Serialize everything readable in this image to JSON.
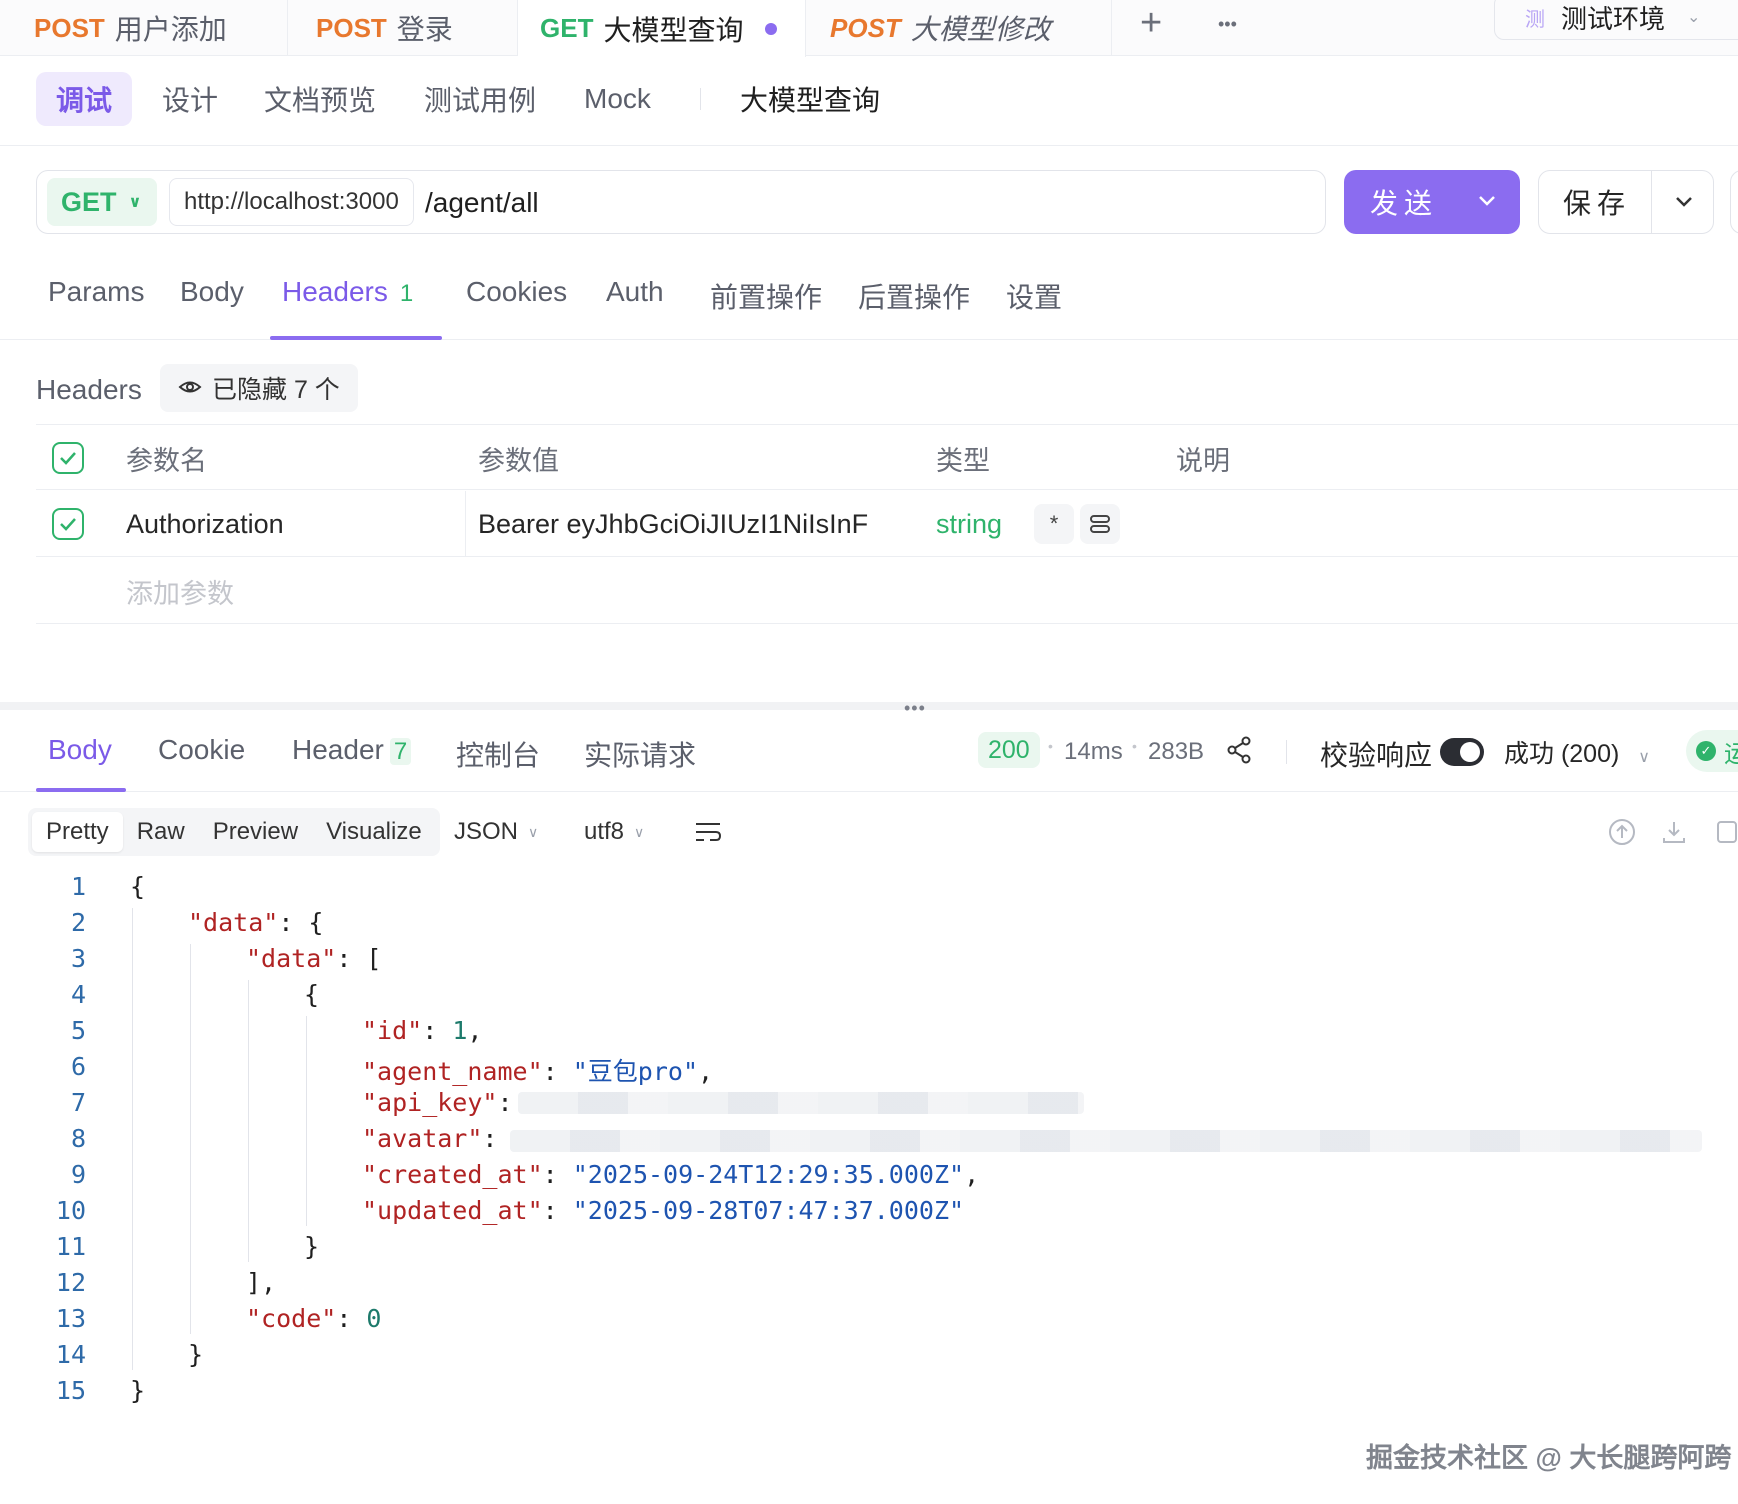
{
  "top_tabs": [
    {
      "method": "POST",
      "title": "用户添加"
    },
    {
      "method": "POST",
      "title": "登录"
    },
    {
      "method": "GET",
      "title": "大模型查询"
    },
    {
      "method": "POST",
      "title": "大模型修改"
    }
  ],
  "top_actions": {
    "add": "+",
    "more": "•••"
  },
  "environment": {
    "badge": "测",
    "label": "测试环境"
  },
  "subnav": {
    "items": [
      "调试",
      "设计",
      "文档预览",
      "测试用例",
      "Mock"
    ],
    "name": "大模型查询"
  },
  "request": {
    "method": "GET",
    "host": "http://localhost:3000",
    "path": "/agent/all",
    "send_label": "发送",
    "save_label": "保存"
  },
  "request_tabs": [
    {
      "label": "Params"
    },
    {
      "label": "Body"
    },
    {
      "label": "Headers",
      "count": "1"
    },
    {
      "label": "Cookies"
    },
    {
      "label": "Auth"
    },
    {
      "label": "前置操作"
    },
    {
      "label": "后置操作"
    },
    {
      "label": "设置"
    }
  ],
  "headers_section": {
    "title": "Headers",
    "hidden_label": "已隐藏 7 个",
    "columns": [
      "参数名",
      "参数值",
      "类型",
      "说明"
    ],
    "rows": [
      {
        "name": "Authorization",
        "value": "Bearer eyJhbGciOiJIUzI1NiIsInF",
        "type": "string",
        "required_mark": "*"
      }
    ],
    "add_placeholder": "添加参数"
  },
  "splitter_grip": "•••",
  "response_tabs": [
    {
      "label": "Body"
    },
    {
      "label": "Cookie"
    },
    {
      "label": "Header",
      "count": "7"
    },
    {
      "label": "控制台"
    },
    {
      "label": "实际请求"
    }
  ],
  "response_meta": {
    "status": "200",
    "time": "14ms",
    "size": "283B",
    "validate_label": "校验响应",
    "validate_on": true,
    "result_select": "成功 (200)",
    "result_pill": "运"
  },
  "view_modes": [
    "Pretty",
    "Raw",
    "Preview",
    "Visualize"
  ],
  "format": {
    "type": "JSON",
    "encoding": "utf8"
  },
  "code_lines": [
    "1",
    "2",
    "3",
    "4",
    "5",
    "6",
    "7",
    "8",
    "9",
    "10",
    "11",
    "12",
    "13",
    "14",
    "15"
  ],
  "json_body": {
    "key_data": "\"data\"",
    "key_id": "\"id\"",
    "val_id": "1",
    "key_agent_name": "\"agent_name\"",
    "val_agent_name": "\"豆包pro\"",
    "key_api_key": "\"api_key\"",
    "key_avatar": "\"avatar\"",
    "key_created_at": "\"created_at\"",
    "val_created_at": "\"2025-09-24T12:29:35.000Z\"",
    "key_updated_at": "\"updated_at\"",
    "val_updated_at": "\"2025-09-28T07:47:37.000Z\"",
    "key_code": "\"code\"",
    "val_code": "0"
  },
  "watermark": "掘金技术社区 @ 大长腿跨阿跨",
  "colors": {
    "accent": "#8b6cf0",
    "get": "#2fb36b",
    "post": "#e8782e"
  }
}
